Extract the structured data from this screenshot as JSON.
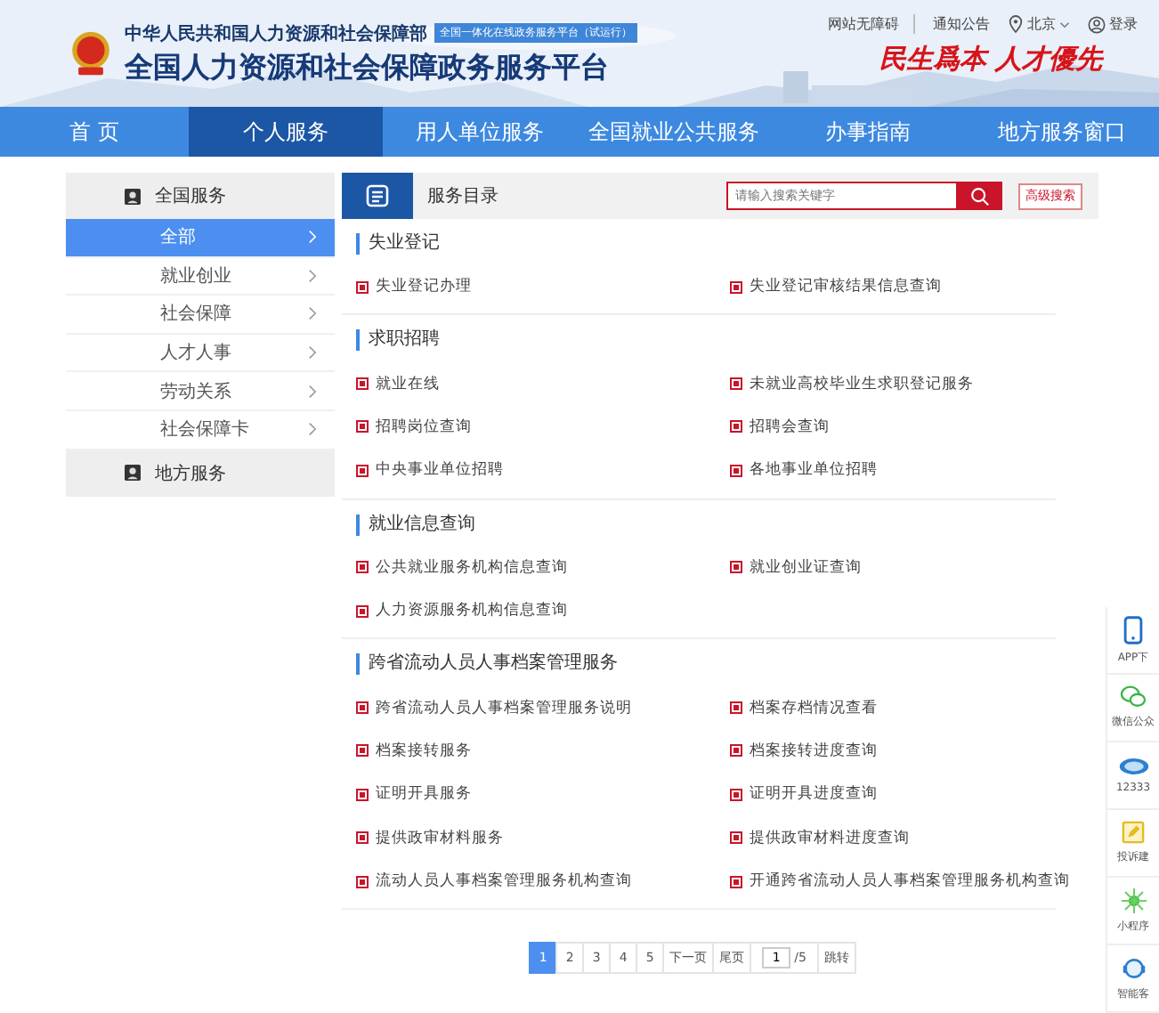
{
  "header": {
    "ministry": "中华人民共和国人力资源和社会保障部",
    "badge": "全国一体化在线政务服务平台（试运行）",
    "title": "全国人力资源和社会保障政务服务平台",
    "slogan": "民生爲本 人才優先",
    "links": [
      {
        "kind": "text",
        "label": "网站无障碍"
      },
      {
        "kind": "text",
        "label": "通知公告"
      },
      {
        "kind": "location",
        "label": "北京"
      },
      {
        "kind": "user",
        "label": "登录"
      }
    ]
  },
  "nav": [
    {
      "label": "首 页",
      "selected": false
    },
    {
      "label": "个人服务",
      "selected": true
    },
    {
      "label": "用人单位服务",
      "selected": false
    },
    {
      "label": "全国就业公共服务",
      "selected": false
    },
    {
      "label": "办事指南",
      "selected": false
    },
    {
      "label": "地方服务窗口",
      "selected": false
    }
  ],
  "sidebar": {
    "groups": [
      {
        "label": "全国服务",
        "items": [
          {
            "label": "全部",
            "selected": true
          },
          {
            "label": "就业创业",
            "selected": false
          },
          {
            "label": "社会保障",
            "selected": false
          },
          {
            "label": "人才人事",
            "selected": false
          },
          {
            "label": "劳动关系",
            "selected": false
          },
          {
            "label": "社会保障卡",
            "selected": false
          }
        ]
      },
      {
        "label": "地方服务"
      }
    ]
  },
  "catalog": {
    "title": "服务目录",
    "search": {
      "placeholder": "请输入搜索关键字"
    },
    "advanced": "高级搜索",
    "sections": [
      {
        "heading": "失业登记",
        "items": [
          "失业登记办理",
          "失业登记审核结果信息查询"
        ]
      },
      {
        "heading": "求职招聘",
        "items": [
          "就业在线",
          "未就业高校毕业生求职登记服务",
          "招聘岗位查询",
          "招聘会查询",
          "中央事业单位招聘",
          "各地事业单位招聘"
        ]
      },
      {
        "heading": "就业信息查询",
        "items": [
          "公共就业服务机构信息查询",
          "就业创业证查询",
          "人力资源服务机构信息查询"
        ]
      },
      {
        "heading": "跨省流动人员人事档案管理服务",
        "items": [
          "跨省流动人员人事档案管理服务说明",
          "档案存档情况查看",
          "档案接转服务",
          "档案接转进度查询",
          "证明开具服务",
          "证明开具进度查询",
          "提供政审材料服务",
          "提供政审材料进度查询",
          "流动人员人事档案管理服务机构查询",
          "开通跨省流动人员人事档案管理服务机构查询"
        ]
      }
    ]
  },
  "pagination": {
    "pages": [
      {
        "label": "1",
        "selected": true
      },
      {
        "label": "2",
        "selected": false
      },
      {
        "label": "3",
        "selected": false
      },
      {
        "label": "4",
        "selected": false
      },
      {
        "label": "5",
        "selected": false
      }
    ],
    "next": "下一页",
    "last": "尾页",
    "page_input": "1",
    "total": "/5",
    "go": "跳转"
  },
  "float_bar": [
    {
      "kind": "phone",
      "label": "APP下"
    },
    {
      "kind": "wechat",
      "label": "微信公众"
    },
    {
      "kind": "hotline",
      "label": "12333"
    },
    {
      "kind": "note",
      "label": "投诉建"
    },
    {
      "kind": "miniapp",
      "label": "小程序"
    },
    {
      "kind": "headset",
      "label": "智能客"
    }
  ]
}
